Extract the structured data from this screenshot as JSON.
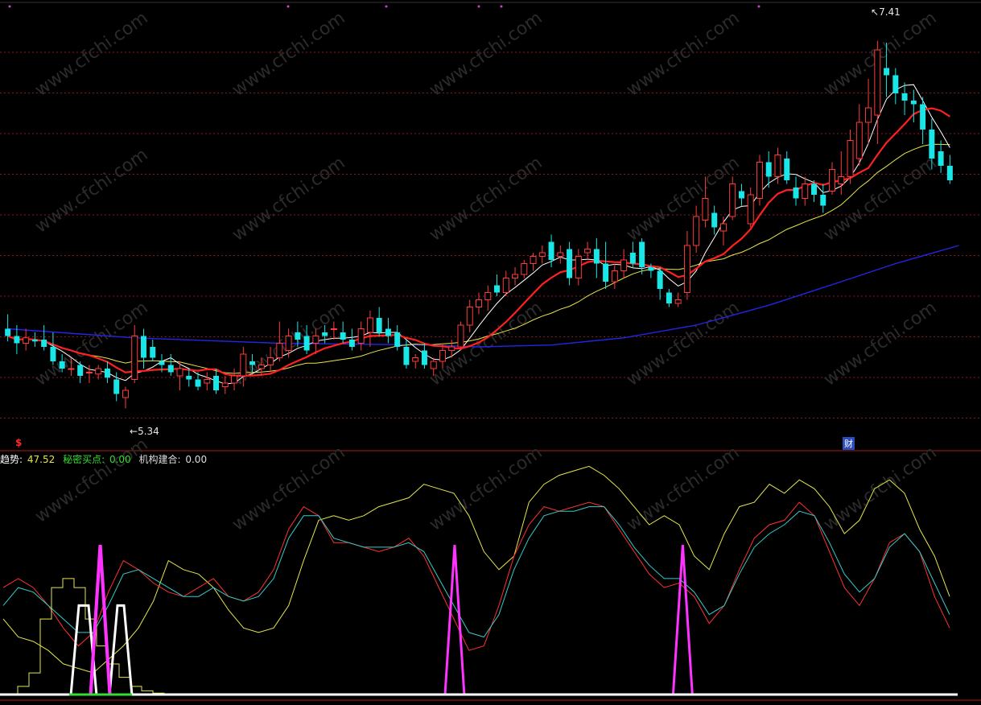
{
  "chart_data": [
    {
      "type": "candlestick",
      "title": "",
      "price_high_label": "7.41",
      "price_low_label": "5.34",
      "y_range": [
        5.2,
        7.6
      ],
      "colors": {
        "up": "#ff3b3b",
        "down": "#19e6e6",
        "ma_short": "#ffffff",
        "ma_mid": "#ff2020",
        "ma_long": "#e6e64a",
        "ma_slow": "#2424e6",
        "grid": "#8a1a1a"
      },
      "candles": [
        {
          "o": 5.82,
          "h": 5.9,
          "l": 5.75,
          "c": 5.78
        },
        {
          "o": 5.78,
          "h": 5.84,
          "l": 5.68,
          "c": 5.74
        },
        {
          "o": 5.74,
          "h": 5.82,
          "l": 5.7,
          "c": 5.77
        },
        {
          "o": 5.76,
          "h": 5.8,
          "l": 5.72,
          "c": 5.75
        },
        {
          "o": 5.76,
          "h": 5.84,
          "l": 5.7,
          "c": 5.72
        },
        {
          "o": 5.72,
          "h": 5.8,
          "l": 5.62,
          "c": 5.64
        },
        {
          "o": 5.64,
          "h": 5.68,
          "l": 5.58,
          "c": 5.6
        },
        {
          "o": 5.6,
          "h": 5.66,
          "l": 5.56,
          "c": 5.6
        },
        {
          "o": 5.62,
          "h": 5.64,
          "l": 5.52,
          "c": 5.56
        },
        {
          "o": 5.58,
          "h": 5.62,
          "l": 5.52,
          "c": 5.58
        },
        {
          "o": 5.57,
          "h": 5.62,
          "l": 5.54,
          "c": 5.6
        },
        {
          "o": 5.6,
          "h": 5.64,
          "l": 5.52,
          "c": 5.55
        },
        {
          "o": 5.54,
          "h": 5.58,
          "l": 5.42,
          "c": 5.46
        },
        {
          "o": 5.44,
          "h": 5.5,
          "l": 5.38,
          "c": 5.48
        },
        {
          "o": 5.54,
          "h": 5.84,
          "l": 5.52,
          "c": 5.78
        },
        {
          "o": 5.78,
          "h": 5.82,
          "l": 5.6,
          "c": 5.66
        },
        {
          "o": 5.72,
          "h": 5.76,
          "l": 5.64,
          "c": 5.66
        },
        {
          "o": 5.64,
          "h": 5.68,
          "l": 5.58,
          "c": 5.62
        },
        {
          "o": 5.62,
          "h": 5.68,
          "l": 5.56,
          "c": 5.58
        },
        {
          "o": 5.56,
          "h": 5.64,
          "l": 5.48,
          "c": 5.6
        },
        {
          "o": 5.56,
          "h": 5.6,
          "l": 5.5,
          "c": 5.54
        },
        {
          "o": 5.54,
          "h": 5.58,
          "l": 5.48,
          "c": 5.5
        },
        {
          "o": 5.52,
          "h": 5.58,
          "l": 5.48,
          "c": 5.54
        },
        {
          "o": 5.56,
          "h": 5.6,
          "l": 5.46,
          "c": 5.48
        },
        {
          "o": 5.5,
          "h": 5.56,
          "l": 5.46,
          "c": 5.52
        },
        {
          "o": 5.52,
          "h": 5.6,
          "l": 5.48,
          "c": 5.56
        },
        {
          "o": 5.56,
          "h": 5.72,
          "l": 5.5,
          "c": 5.68
        },
        {
          "o": 5.64,
          "h": 5.68,
          "l": 5.58,
          "c": 5.62
        },
        {
          "o": 5.6,
          "h": 5.66,
          "l": 5.56,
          "c": 5.62
        },
        {
          "o": 5.62,
          "h": 5.72,
          "l": 5.58,
          "c": 5.66
        },
        {
          "o": 5.66,
          "h": 5.86,
          "l": 5.64,
          "c": 5.74
        },
        {
          "o": 5.7,
          "h": 5.82,
          "l": 5.66,
          "c": 5.78
        },
        {
          "o": 5.8,
          "h": 5.86,
          "l": 5.72,
          "c": 5.76
        },
        {
          "o": 5.78,
          "h": 5.84,
          "l": 5.68,
          "c": 5.7
        },
        {
          "o": 5.74,
          "h": 5.82,
          "l": 5.68,
          "c": 5.78
        },
        {
          "o": 5.8,
          "h": 5.84,
          "l": 5.74,
          "c": 5.78
        },
        {
          "o": 5.82,
          "h": 5.86,
          "l": 5.76,
          "c": 5.82
        },
        {
          "o": 5.8,
          "h": 5.86,
          "l": 5.74,
          "c": 5.76
        },
        {
          "o": 5.76,
          "h": 5.82,
          "l": 5.7,
          "c": 5.72
        },
        {
          "o": 5.74,
          "h": 5.86,
          "l": 5.7,
          "c": 5.82
        },
        {
          "o": 5.8,
          "h": 5.92,
          "l": 5.72,
          "c": 5.88
        },
        {
          "o": 5.88,
          "h": 5.94,
          "l": 5.78,
          "c": 5.8
        },
        {
          "o": 5.82,
          "h": 5.88,
          "l": 5.74,
          "c": 5.78
        },
        {
          "o": 5.8,
          "h": 5.84,
          "l": 5.7,
          "c": 5.72
        },
        {
          "o": 5.72,
          "h": 5.76,
          "l": 5.6,
          "c": 5.62
        },
        {
          "o": 5.64,
          "h": 5.68,
          "l": 5.6,
          "c": 5.66
        },
        {
          "o": 5.7,
          "h": 5.74,
          "l": 5.6,
          "c": 5.62
        },
        {
          "o": 5.6,
          "h": 5.66,
          "l": 5.56,
          "c": 5.64
        },
        {
          "o": 5.64,
          "h": 5.74,
          "l": 5.6,
          "c": 5.7
        },
        {
          "o": 5.7,
          "h": 5.76,
          "l": 5.66,
          "c": 5.72
        },
        {
          "o": 5.72,
          "h": 5.86,
          "l": 5.7,
          "c": 5.84
        },
        {
          "o": 5.84,
          "h": 5.98,
          "l": 5.8,
          "c": 5.94
        },
        {
          "o": 5.94,
          "h": 6.02,
          "l": 5.9,
          "c": 5.98
        },
        {
          "o": 5.98,
          "h": 6.06,
          "l": 5.92,
          "c": 6.02
        },
        {
          "o": 6.06,
          "h": 6.12,
          "l": 6.0,
          "c": 6.02
        },
        {
          "o": 6.02,
          "h": 6.14,
          "l": 6.0,
          "c": 6.1
        },
        {
          "o": 6.1,
          "h": 6.16,
          "l": 6.06,
          "c": 6.12
        },
        {
          "o": 6.12,
          "h": 6.2,
          "l": 6.1,
          "c": 6.18
        },
        {
          "o": 6.18,
          "h": 6.24,
          "l": 6.14,
          "c": 6.22
        },
        {
          "o": 6.22,
          "h": 6.28,
          "l": 6.18,
          "c": 6.24
        },
        {
          "o": 6.3,
          "h": 6.34,
          "l": 6.16,
          "c": 6.2
        },
        {
          "o": 6.22,
          "h": 6.28,
          "l": 6.18,
          "c": 6.24
        },
        {
          "o": 6.26,
          "h": 6.3,
          "l": 6.06,
          "c": 6.1
        },
        {
          "o": 6.1,
          "h": 6.26,
          "l": 6.06,
          "c": 6.22
        },
        {
          "o": 6.24,
          "h": 6.3,
          "l": 6.2,
          "c": 6.26
        },
        {
          "o": 6.26,
          "h": 6.32,
          "l": 6.1,
          "c": 6.18
        },
        {
          "o": 6.18,
          "h": 6.3,
          "l": 6.04,
          "c": 6.08
        },
        {
          "o": 6.08,
          "h": 6.18,
          "l": 6.04,
          "c": 6.14
        },
        {
          "o": 6.14,
          "h": 6.26,
          "l": 6.1,
          "c": 6.2
        },
        {
          "o": 6.24,
          "h": 6.3,
          "l": 6.16,
          "c": 6.18
        },
        {
          "o": 6.3,
          "h": 6.32,
          "l": 6.12,
          "c": 6.16
        },
        {
          "o": 6.16,
          "h": 6.18,
          "l": 6.1,
          "c": 6.14
        },
        {
          "o": 6.14,
          "h": 6.16,
          "l": 5.98,
          "c": 6.04
        },
        {
          "o": 6.02,
          "h": 6.04,
          "l": 5.94,
          "c": 5.96
        },
        {
          "o": 5.96,
          "h": 6.02,
          "l": 5.94,
          "c": 5.98
        },
        {
          "o": 6.02,
          "h": 6.36,
          "l": 5.98,
          "c": 6.28
        },
        {
          "o": 6.28,
          "h": 6.5,
          "l": 6.24,
          "c": 6.44
        },
        {
          "o": 6.42,
          "h": 6.66,
          "l": 6.38,
          "c": 6.54
        },
        {
          "o": 6.46,
          "h": 6.5,
          "l": 6.34,
          "c": 6.38
        },
        {
          "o": 6.36,
          "h": 6.44,
          "l": 6.28,
          "c": 6.4
        },
        {
          "o": 6.44,
          "h": 6.66,
          "l": 6.42,
          "c": 6.62
        },
        {
          "o": 6.58,
          "h": 6.62,
          "l": 6.5,
          "c": 6.54
        },
        {
          "o": 6.4,
          "h": 6.6,
          "l": 6.38,
          "c": 6.56
        },
        {
          "o": 6.54,
          "h": 6.78,
          "l": 6.5,
          "c": 6.74
        },
        {
          "o": 6.74,
          "h": 6.8,
          "l": 6.6,
          "c": 6.66
        },
        {
          "o": 6.66,
          "h": 6.82,
          "l": 6.62,
          "c": 6.78
        },
        {
          "o": 6.76,
          "h": 6.8,
          "l": 6.62,
          "c": 6.64
        },
        {
          "o": 6.6,
          "h": 6.66,
          "l": 6.5,
          "c": 6.54
        },
        {
          "o": 6.54,
          "h": 6.66,
          "l": 6.5,
          "c": 6.62
        },
        {
          "o": 6.62,
          "h": 6.64,
          "l": 6.52,
          "c": 6.56
        },
        {
          "o": 6.56,
          "h": 6.62,
          "l": 6.46,
          "c": 6.5
        },
        {
          "o": 6.58,
          "h": 6.74,
          "l": 6.56,
          "c": 6.7
        },
        {
          "o": 6.62,
          "h": 6.8,
          "l": 6.56,
          "c": 6.66
        },
        {
          "o": 6.66,
          "h": 6.92,
          "l": 6.62,
          "c": 6.86
        },
        {
          "o": 6.76,
          "h": 7.06,
          "l": 6.72,
          "c": 6.96
        },
        {
          "o": 6.96,
          "h": 7.2,
          "l": 6.84,
          "c": 7.04
        },
        {
          "o": 7.0,
          "h": 7.41,
          "l": 6.84,
          "c": 7.36
        },
        {
          "o": 7.26,
          "h": 7.4,
          "l": 7.1,
          "c": 7.22
        },
        {
          "o": 7.22,
          "h": 7.26,
          "l": 7.06,
          "c": 7.12
        },
        {
          "o": 7.12,
          "h": 7.18,
          "l": 7.0,
          "c": 7.08
        },
        {
          "o": 7.08,
          "h": 7.14,
          "l": 6.96,
          "c": 7.06
        },
        {
          "o": 7.06,
          "h": 7.1,
          "l": 6.84,
          "c": 6.92
        },
        {
          "o": 6.92,
          "h": 6.98,
          "l": 6.7,
          "c": 6.76
        },
        {
          "o": 6.8,
          "h": 6.86,
          "l": 6.68,
          "c": 6.72
        },
        {
          "o": 6.72,
          "h": 6.78,
          "l": 6.62,
          "c": 6.64
        }
      ],
      "ma_slow": [
        {
          "x": 0,
          "y": 5.82
        },
        {
          "x": 14,
          "y": 5.77
        },
        {
          "x": 30,
          "y": 5.74
        },
        {
          "x": 46,
          "y": 5.73
        },
        {
          "x": 52,
          "y": 5.72
        },
        {
          "x": 60,
          "y": 5.73
        },
        {
          "x": 68,
          "y": 5.77
        },
        {
          "x": 76,
          "y": 5.84
        },
        {
          "x": 84,
          "y": 5.95
        },
        {
          "x": 92,
          "y": 6.08
        },
        {
          "x": 98,
          "y": 6.18
        },
        {
          "x": 105,
          "y": 6.28
        }
      ]
    },
    {
      "type": "line",
      "title": "",
      "y_range": [
        0,
        100
      ],
      "legend": [
        {
          "label": "趋势:",
          "value": "47.52",
          "color": "#ffffff",
          "value_color": "#e6e64a"
        },
        {
          "label": "秘密买点:",
          "value": "0.00",
          "color": "#33dd33",
          "value_color": "#33dd33"
        },
        {
          "label": "机构建合:",
          "value": "0.00",
          "color": "#dddddd",
          "value_color": "#dddddd"
        }
      ],
      "series": [
        {
          "color": "#e6e64a",
          "values": [
            34,
            26,
            24,
            20,
            14,
            12,
            10,
            16,
            22,
            30,
            42,
            60,
            56,
            54,
            48,
            38,
            30,
            28,
            30,
            40,
            60,
            78,
            80,
            78,
            80,
            84,
            86,
            88,
            94,
            92,
            90,
            80,
            64,
            56,
            62,
            86,
            94,
            98,
            100,
            102,
            98,
            92,
            84,
            76,
            80,
            76,
            62,
            56,
            72,
            84,
            86,
            94,
            90,
            96,
            92,
            84,
            72,
            78,
            92,
            96,
            90,
            74,
            62,
            44
          ]
        },
        {
          "color": "#ff3030",
          "values": [
            48,
            52,
            48,
            40,
            30,
            22,
            28,
            46,
            60,
            56,
            50,
            46,
            44,
            48,
            52,
            44,
            42,
            46,
            56,
            74,
            84,
            80,
            68,
            68,
            66,
            64,
            66,
            70,
            62,
            48,
            34,
            20,
            22,
            40,
            62,
            76,
            84,
            82,
            84,
            86,
            84,
            74,
            64,
            54,
            48,
            50,
            44,
            32,
            40,
            56,
            70,
            76,
            78,
            86,
            80,
            64,
            48,
            40,
            52,
            68,
            72,
            64,
            44,
            30
          ]
        },
        {
          "color": "#33cccc",
          "values": [
            40,
            48,
            46,
            40,
            34,
            28,
            28,
            40,
            54,
            56,
            52,
            48,
            44,
            44,
            48,
            44,
            42,
            44,
            52,
            70,
            80,
            80,
            70,
            68,
            66,
            66,
            66,
            68,
            64,
            52,
            40,
            28,
            26,
            36,
            56,
            70,
            80,
            82,
            82,
            84,
            84,
            76,
            66,
            58,
            52,
            52,
            46,
            36,
            40,
            54,
            66,
            72,
            76,
            82,
            80,
            68,
            54,
            46,
            52,
            66,
            72,
            64,
            50,
            36
          ]
        }
      ],
      "signals": [
        {
          "color": "#ff33ff",
          "kind": "spike",
          "x_fraction": 0.103
        },
        {
          "color": "#ff33ff",
          "kind": "spike",
          "x_fraction": 0.477
        },
        {
          "color": "#ff33ff",
          "kind": "spike",
          "x_fraction": 0.718
        }
      ]
    }
  ],
  "markers": {
    "capital_marker": "$",
    "finance_marker": "财"
  },
  "watermark": "www.cfchi.com"
}
